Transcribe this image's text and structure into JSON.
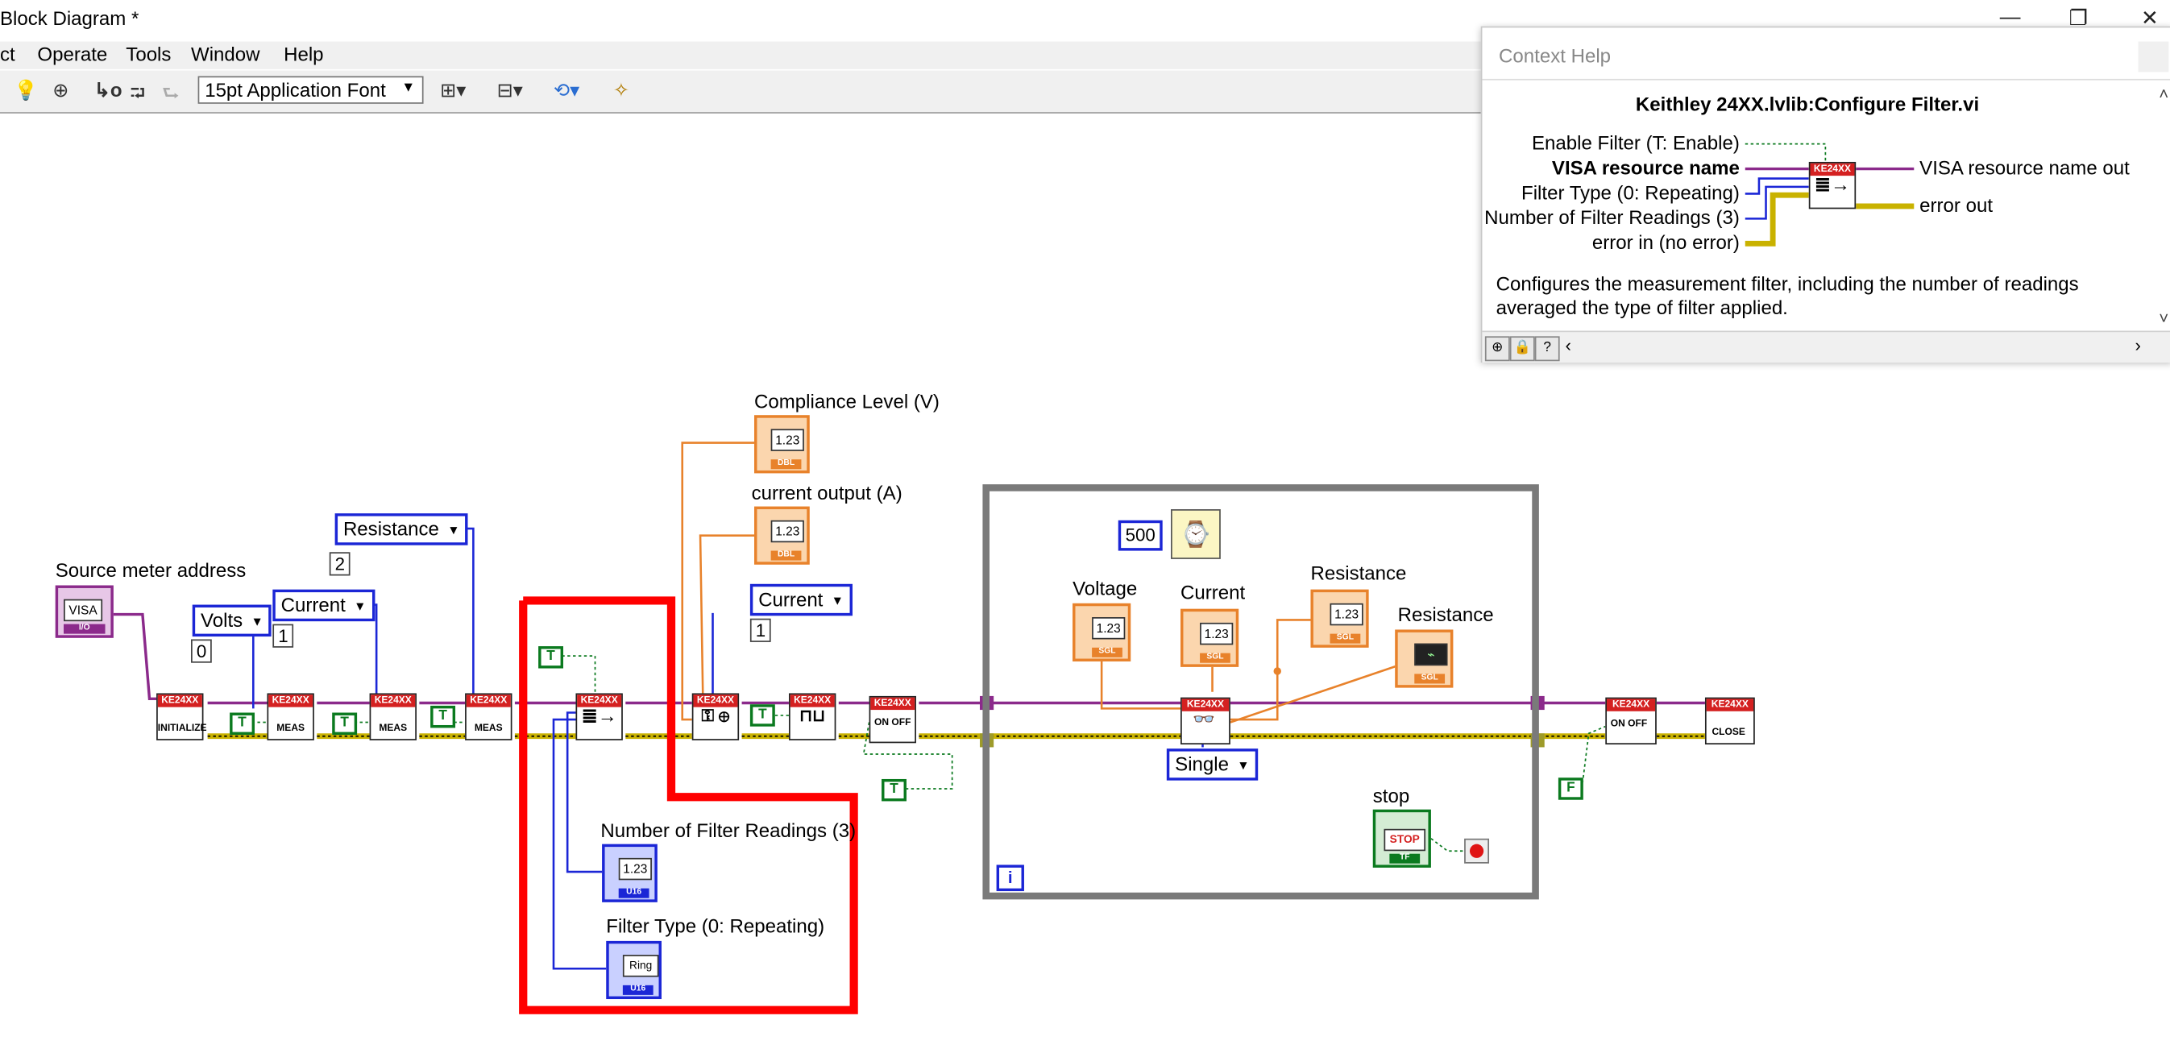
{
  "window": {
    "title": "Block Diagram *",
    "controls": {
      "minimize": "—",
      "restore": "❐",
      "close": "✕"
    }
  },
  "menu": [
    "ct",
    "Operate",
    "Tools",
    "Window",
    "Help"
  ],
  "toolbar": {
    "font": "15pt Application Font",
    "icons": [
      "highlight-execution-icon",
      "retain-wire-values-icon",
      "step-into-icon",
      "step-over-icon",
      "step-out-icon",
      "align-objects-icon",
      "distribute-objects-icon",
      "reorder-icon",
      "clean-up-diagram-icon"
    ]
  },
  "diagram": {
    "labels": {
      "source_meter_address": "Source meter address",
      "compliance_level": "Compliance  Level (V)",
      "current_output": "current output (A)",
      "voltage": "Voltage",
      "current": "Current",
      "resistance1": "Resistance",
      "resistance2": "Resistance",
      "stop": "stop",
      "num_filter_readings": "Number of Filter Readings (3)",
      "filter_type": "Filter Type  (0: Repeating)"
    },
    "enums": {
      "volts": "Volts",
      "current_a": "Current",
      "resistance": "Resistance",
      "current_b": "Current",
      "single": "Single"
    },
    "constants": {
      "c0": "0",
      "c1": "1",
      "c2": "2",
      "c1b": "1",
      "wait_ms": "500",
      "true": "T",
      "false": "F"
    },
    "terminal_text": {
      "visa": "VISA",
      "num": "1.23",
      "ring": "Ring",
      "stop": "STOP",
      "dbl": "DBL",
      "sgl": "SGL",
      "u16": "U16",
      "io": "I/O",
      "tf": "TF"
    },
    "vi_text": {
      "header": "KE24XX",
      "initialize": "INITIALIZE",
      "meas": "MEAS",
      "on_off": "ON OFF",
      "close": "CLOSE"
    },
    "loop_iteration": "i"
  },
  "context_help": {
    "title": "Context Help",
    "vi_name": "Keithley 24XX.lvlib:Configure Filter.vi",
    "inputs": [
      "Enable Filter  (T: Enable)",
      "VISA resource name",
      "Filter Type  (0: Repeating)",
      "Number of Filter Readings (3)",
      "error in (no error)"
    ],
    "outputs": [
      "VISA resource name out",
      "error out"
    ],
    "description": "Configures the measurement filter, including the number of readings averaged the type of filter applied."
  },
  "colors": {
    "error_wire": "#c9b200",
    "visa_wire": "#8b2a8b",
    "blue_wire": "#1b26d6",
    "orange_wire": "#e8822b",
    "bool_wire": "#0b7a1f",
    "highlight": "#ff0000",
    "loop_border": "#7a7a7a"
  }
}
